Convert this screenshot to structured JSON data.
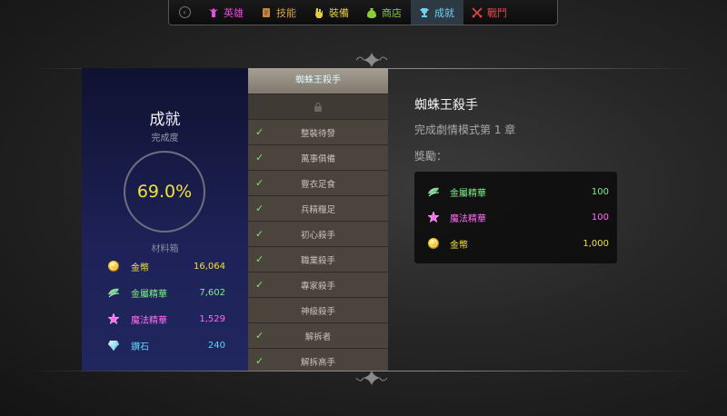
{
  "nav": {
    "tabs": [
      {
        "label": "英雄",
        "icon": "hero-icon",
        "color": "#e24fd8"
      },
      {
        "label": "技能",
        "icon": "scroll-icon",
        "color": "#d8a050"
      },
      {
        "label": "裝備",
        "icon": "gauntlet-icon",
        "color": "#e0d040"
      },
      {
        "label": "商店",
        "icon": "money-bag-icon",
        "color": "#8ccc3a"
      },
      {
        "label": "成就",
        "icon": "trophy-icon",
        "color": "#6ed0f0",
        "active": true
      },
      {
        "label": "戰鬥",
        "icon": "crossed-swords-icon",
        "color": "#e04848"
      }
    ]
  },
  "profile": {
    "title": "成就",
    "completion_label": "完成度",
    "completion": "69.0%",
    "materials_label": "材料箱",
    "materials": [
      {
        "label": "金幣",
        "value": "16,064",
        "icon": "gold-coin-icon",
        "color": "#f3e13a"
      },
      {
        "label": "金屬精華",
        "value": "7,602",
        "icon": "metal-essence-icon",
        "color": "#7ef28a"
      },
      {
        "label": "魔法精華",
        "value": "1,529",
        "icon": "magic-essence-icon",
        "color": "#ff6ef3"
      },
      {
        "label": "鑽石",
        "value": "240",
        "icon": "diamond-icon",
        "color": "#5ad7f7"
      }
    ]
  },
  "achievements": {
    "selected": "蜘蛛王殺手",
    "items": [
      {
        "label": "整裝待發",
        "done": true
      },
      {
        "label": "萬事俱備",
        "done": true
      },
      {
        "label": "豐衣足食",
        "done": true
      },
      {
        "label": "兵精糧足",
        "done": true
      },
      {
        "label": "初心殺手",
        "done": true
      },
      {
        "label": "職業殺手",
        "done": true
      },
      {
        "label": "專家殺手",
        "done": true
      },
      {
        "label": "神級殺手",
        "done": false
      },
      {
        "label": "解拆者",
        "done": true
      },
      {
        "label": "解拆高手",
        "done": true
      }
    ]
  },
  "detail": {
    "title": "蜘蛛王殺手",
    "description": "完成劇情模式第 1 章",
    "reward_label": "獎勵：",
    "rewards": [
      {
        "label": "金屬精華",
        "value": "100",
        "icon": "metal-essence-icon",
        "color": "#7ef28a"
      },
      {
        "label": "魔法精華",
        "value": "100",
        "icon": "magic-essence-icon",
        "color": "#ff6ef3"
      },
      {
        "label": "金幣",
        "value": "1,000",
        "icon": "gold-coin-icon",
        "color": "#f3e13a"
      }
    ]
  }
}
